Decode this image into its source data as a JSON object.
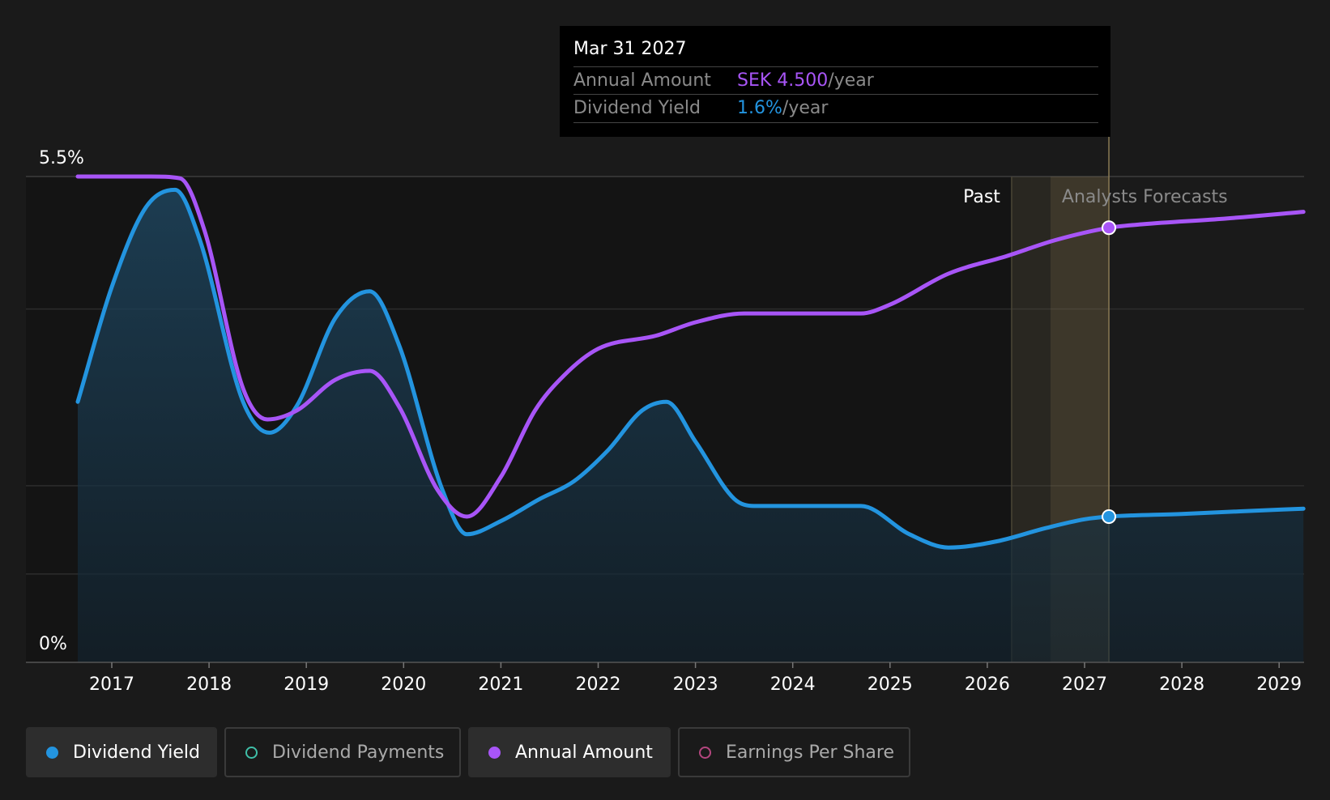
{
  "colors": {
    "yield": "#2394df",
    "annual": "#a855f7",
    "payments": "#3fbfa8",
    "eps": "#b4467f",
    "forecast_band": "#a08a5a",
    "background": "#1a1a1a"
  },
  "tooltip": {
    "date": "Mar 31 2027",
    "rows": [
      {
        "label": "Annual Amount",
        "value": "SEK 4.500",
        "unit": "/year"
      },
      {
        "label": "Dividend Yield",
        "value": "1.6%",
        "unit": "/year"
      }
    ]
  },
  "legend": [
    {
      "label": "Dividend Yield",
      "icon": "filled-dot",
      "color": "#2394df",
      "active": true
    },
    {
      "label": "Dividend Payments",
      "icon": "hollow-dot",
      "color": "#3fbfa8",
      "active": false
    },
    {
      "label": "Annual Amount",
      "icon": "filled-dot",
      "color": "#a855f7",
      "active": true
    },
    {
      "label": "Earnings Per Share",
      "icon": "hollow-dot",
      "color": "#b4467f",
      "active": false
    }
  ],
  "chart_data": {
    "type": "line",
    "y_axis": {
      "min": 0,
      "max": 5.5,
      "unit": "%",
      "tick_labels": [
        "5.5%",
        "0%"
      ],
      "gridlines": [
        1.0,
        2.0,
        4.0
      ]
    },
    "x_axis": {
      "min": 2016.5,
      "max": 2029.25,
      "ticks": [
        2017,
        2018,
        2019,
        2020,
        2021,
        2022,
        2023,
        2024,
        2025,
        2026,
        2027,
        2028,
        2029
      ]
    },
    "regions": {
      "past_label": "Past",
      "forecast_label": "Analysts Forecasts",
      "past_end": 2026.25,
      "forecast_start": 2026.65,
      "cursor": 2027.25
    },
    "series": [
      {
        "name": "Dividend Yield",
        "key": "yield",
        "fill": true,
        "points": [
          [
            2016.65,
            2.95
          ],
          [
            2017.0,
            4.25
          ],
          [
            2017.35,
            5.15
          ],
          [
            2017.65,
            5.35
          ],
          [
            2017.9,
            4.8
          ],
          [
            2018.35,
            2.95
          ],
          [
            2018.62,
            2.6
          ],
          [
            2018.9,
            2.9
          ],
          [
            2019.3,
            3.9
          ],
          [
            2019.65,
            4.2
          ],
          [
            2019.95,
            3.6
          ],
          [
            2020.4,
            1.95
          ],
          [
            2020.65,
            1.45
          ],
          [
            2021.0,
            1.6
          ],
          [
            2021.4,
            1.85
          ],
          [
            2021.75,
            2.05
          ],
          [
            2022.1,
            2.4
          ],
          [
            2022.45,
            2.85
          ],
          [
            2022.7,
            2.95
          ],
          [
            2023.0,
            2.5
          ],
          [
            2023.4,
            1.85
          ],
          [
            2023.6,
            1.77
          ],
          [
            2024.0,
            1.77
          ],
          [
            2024.7,
            1.77
          ],
          [
            2025.2,
            1.45
          ],
          [
            2025.6,
            1.3
          ],
          [
            2026.1,
            1.37
          ],
          [
            2026.6,
            1.52
          ],
          [
            2027.0,
            1.62
          ],
          [
            2027.25,
            1.65
          ],
          [
            2028.0,
            1.68
          ],
          [
            2028.6,
            1.71
          ],
          [
            2029.25,
            1.74
          ]
        ]
      },
      {
        "name": "Annual Amount",
        "key": "annual",
        "fill": false,
        "points": [
          [
            2016.65,
            5.5
          ],
          [
            2017.0,
            5.5
          ],
          [
            2017.4,
            5.5
          ],
          [
            2017.7,
            5.48
          ],
          [
            2017.95,
            4.9
          ],
          [
            2018.35,
            3.1
          ],
          [
            2018.6,
            2.75
          ],
          [
            2018.9,
            2.85
          ],
          [
            2019.3,
            3.2
          ],
          [
            2019.65,
            3.3
          ],
          [
            2019.95,
            2.9
          ],
          [
            2020.35,
            1.95
          ],
          [
            2020.65,
            1.65
          ],
          [
            2021.0,
            2.1
          ],
          [
            2021.35,
            2.85
          ],
          [
            2021.65,
            3.25
          ],
          [
            2022.0,
            3.55
          ],
          [
            2022.6,
            3.7
          ],
          [
            2023.0,
            3.85
          ],
          [
            2023.5,
            3.95
          ],
          [
            2024.0,
            3.95
          ],
          [
            2024.7,
            3.95
          ],
          [
            2025.0,
            4.05
          ],
          [
            2025.6,
            4.4
          ],
          [
            2026.2,
            4.6
          ],
          [
            2026.7,
            4.78
          ],
          [
            2027.25,
            4.92
          ],
          [
            2027.6,
            4.96
          ],
          [
            2028.4,
            5.02
          ],
          [
            2029.25,
            5.1
          ]
        ]
      }
    ]
  }
}
